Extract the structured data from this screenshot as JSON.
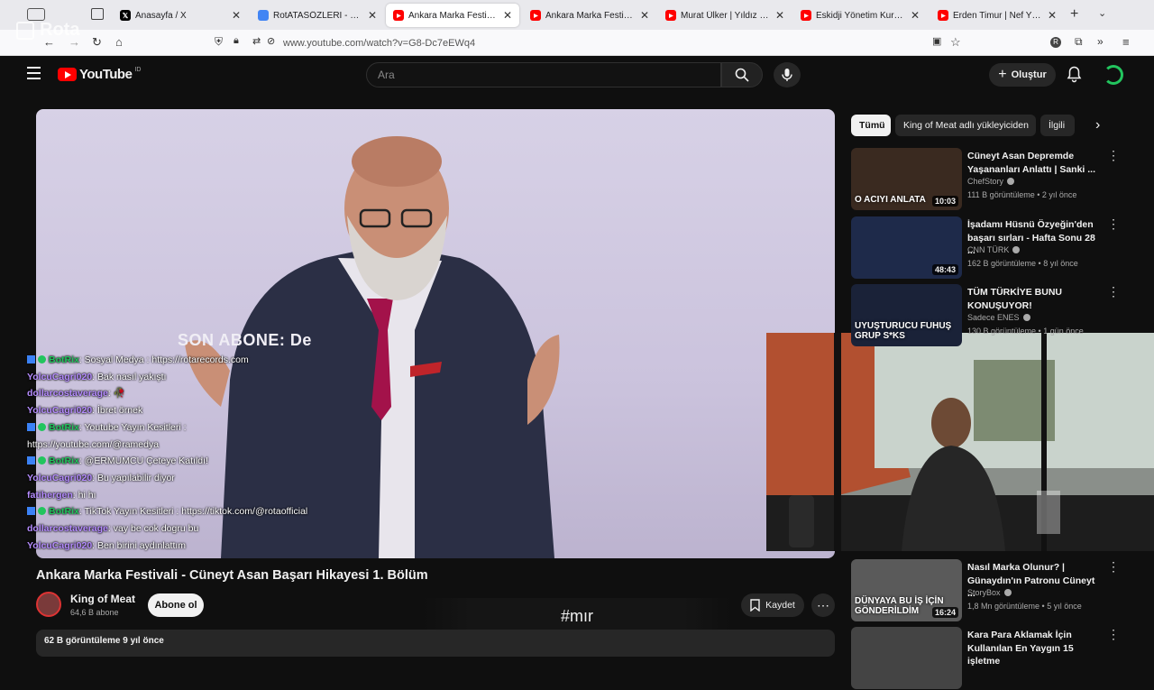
{
  "browser": {
    "tabs": [
      {
        "label": "Anasayfa / X",
        "fav": "x-icon",
        "color": "#000000"
      },
      {
        "label": "RotATASÖZLERİ - Google D",
        "fav": "google-docs-icon",
        "color": "#4285f4"
      },
      {
        "label": "Ankara Marka Festivali - Cün",
        "fav": "youtube-icon",
        "color": "#ff0000"
      },
      {
        "label": "Ankara Marka Festivali - Cün",
        "fav": "youtube-icon",
        "color": "#ff0000"
      },
      {
        "label": "Murat Ülker | Yıldız Holding",
        "fav": "youtube-icon",
        "color": "#ff0000"
      },
      {
        "label": "Eskidji Yönetim Kurulu Başkı",
        "fav": "youtube-icon",
        "color": "#ff0000"
      },
      {
        "label": "Erden Timur | Nef Yönetim K",
        "fav": "youtube-icon",
        "color": "#ff0000"
      }
    ],
    "url": "www.youtube.com/watch?v=G8-Dc7eEWq4",
    "overlay_logo": "Rota"
  },
  "youtube": {
    "logo_text": "YouTube",
    "logo_region": "ID",
    "search_placeholder": "Ara",
    "create_label": "Oluştur"
  },
  "video": {
    "overlay_text": "SON ABONE: De",
    "title": "Ankara Marka Festivali - Cüneyt Asan Başarı Hikayesi 1. Bölüm",
    "channel": "King of Meat",
    "subscribers": "64,6 B abone",
    "subscribe_label": "Abone ol",
    "save_label": "Kaydet",
    "views_date": "62 B görüntüleme  9 yıl önce",
    "stream_tag": "#mır"
  },
  "chat": [
    {
      "user": "BotRix",
      "user_color": "#22c55e",
      "text": ": Sosyal Medya : https://rotarecords.com",
      "bot": true
    },
    {
      "user": "YolcuCagri020",
      "user_color": "#b58cff",
      "text": ": Bak nasıl yakıştı",
      "bot": false
    },
    {
      "user": "dollarcostaverage",
      "user_color": "#b58cff",
      "text": ": 🥀",
      "bot": false
    },
    {
      "user": "YolcuCagri020",
      "user_color": "#b58cff",
      "text": ": İbret örnek",
      "bot": false
    },
    {
      "user": "BotRix",
      "user_color": "#22c55e",
      "text": ": Youtube Yayın Kesitleri :",
      "bot": true
    },
    {
      "user": "",
      "user_color": "#ffffff",
      "text": "https://youtube.com/@ramedya",
      "bot": false
    },
    {
      "user": "BotRix",
      "user_color": "#22c55e",
      "text": ": @ERMUMCU Çeteye Katıldı!",
      "bot": true
    },
    {
      "user": "YolcuCagri020",
      "user_color": "#b58cff",
      "text": ": Bu yapılabilir diyor",
      "bot": false
    },
    {
      "user": "fatihergen",
      "user_color": "#b58cff",
      "text": ": hi hı",
      "bot": false
    },
    {
      "user": "BotRix",
      "user_color": "#22c55e",
      "text": ": TikTok Yayın Kesitleri : https://tiktok.com/@rotaofficial",
      "bot": true
    },
    {
      "user": "dollarcostaverage",
      "user_color": "#b58cff",
      "text": ": vay be cok dogru bu",
      "bot": false
    },
    {
      "user": "YolcuCagri020",
      "user_color": "#b58cff",
      "text": ": Ben birini aydınlattım",
      "bot": false
    }
  ],
  "chips": [
    "Tümü",
    "King of Meat adlı yükleyiciden",
    "İlgili"
  ],
  "recommendations": [
    {
      "title": "Cüneyt Asan Depremde Yaşananları Anlattı | Sanki ...",
      "channel": "ChefStory",
      "meta": "111 B görüntüleme • 2 yıl önce",
      "duration": "10:03",
      "thumb_text": "O ACIYI ANLATA",
      "thumb_color": "#3a2a20"
    },
    {
      "title": "İşadamı Hüsnü Özyeğin'den başarı sırları - Hafta Sonu 28 ...",
      "channel": "CNN TÜRK",
      "meta": "162 B görüntüleme • 8 yıl önce",
      "duration": "48:43",
      "thumb_text": "",
      "thumb_color": "#1e2a4a"
    },
    {
      "title": "TÜM TÜRKİYE BUNU KONUŞUYOR!",
      "channel": "Sadece ENES",
      "meta": "130 B görüntüleme • 1 gün önce",
      "duration": "",
      "thumb_text": "UYUŞTURUCU FUHUŞ GRUP S*KS",
      "thumb_color": "#1a2238"
    },
    {
      "title": "Nasıl Marka Olunur? | Günaydın'ın Patronu Cüneyt ...",
      "channel": "StoryBox",
      "meta": "1,8 Mn görüntüleme • 5 yıl önce",
      "duration": "16:24",
      "thumb_text": "DÜNYAYA BU İŞ İÇİN GÖNDERİLDİM",
      "thumb_color": "#5a5a5a"
    },
    {
      "title": "Kara Para Aklamak İçin Kullanılan En Yaygın 15 işletme",
      "channel": "",
      "meta": "",
      "duration": "",
      "thumb_text": "",
      "thumb_color": "#444444"
    }
  ]
}
